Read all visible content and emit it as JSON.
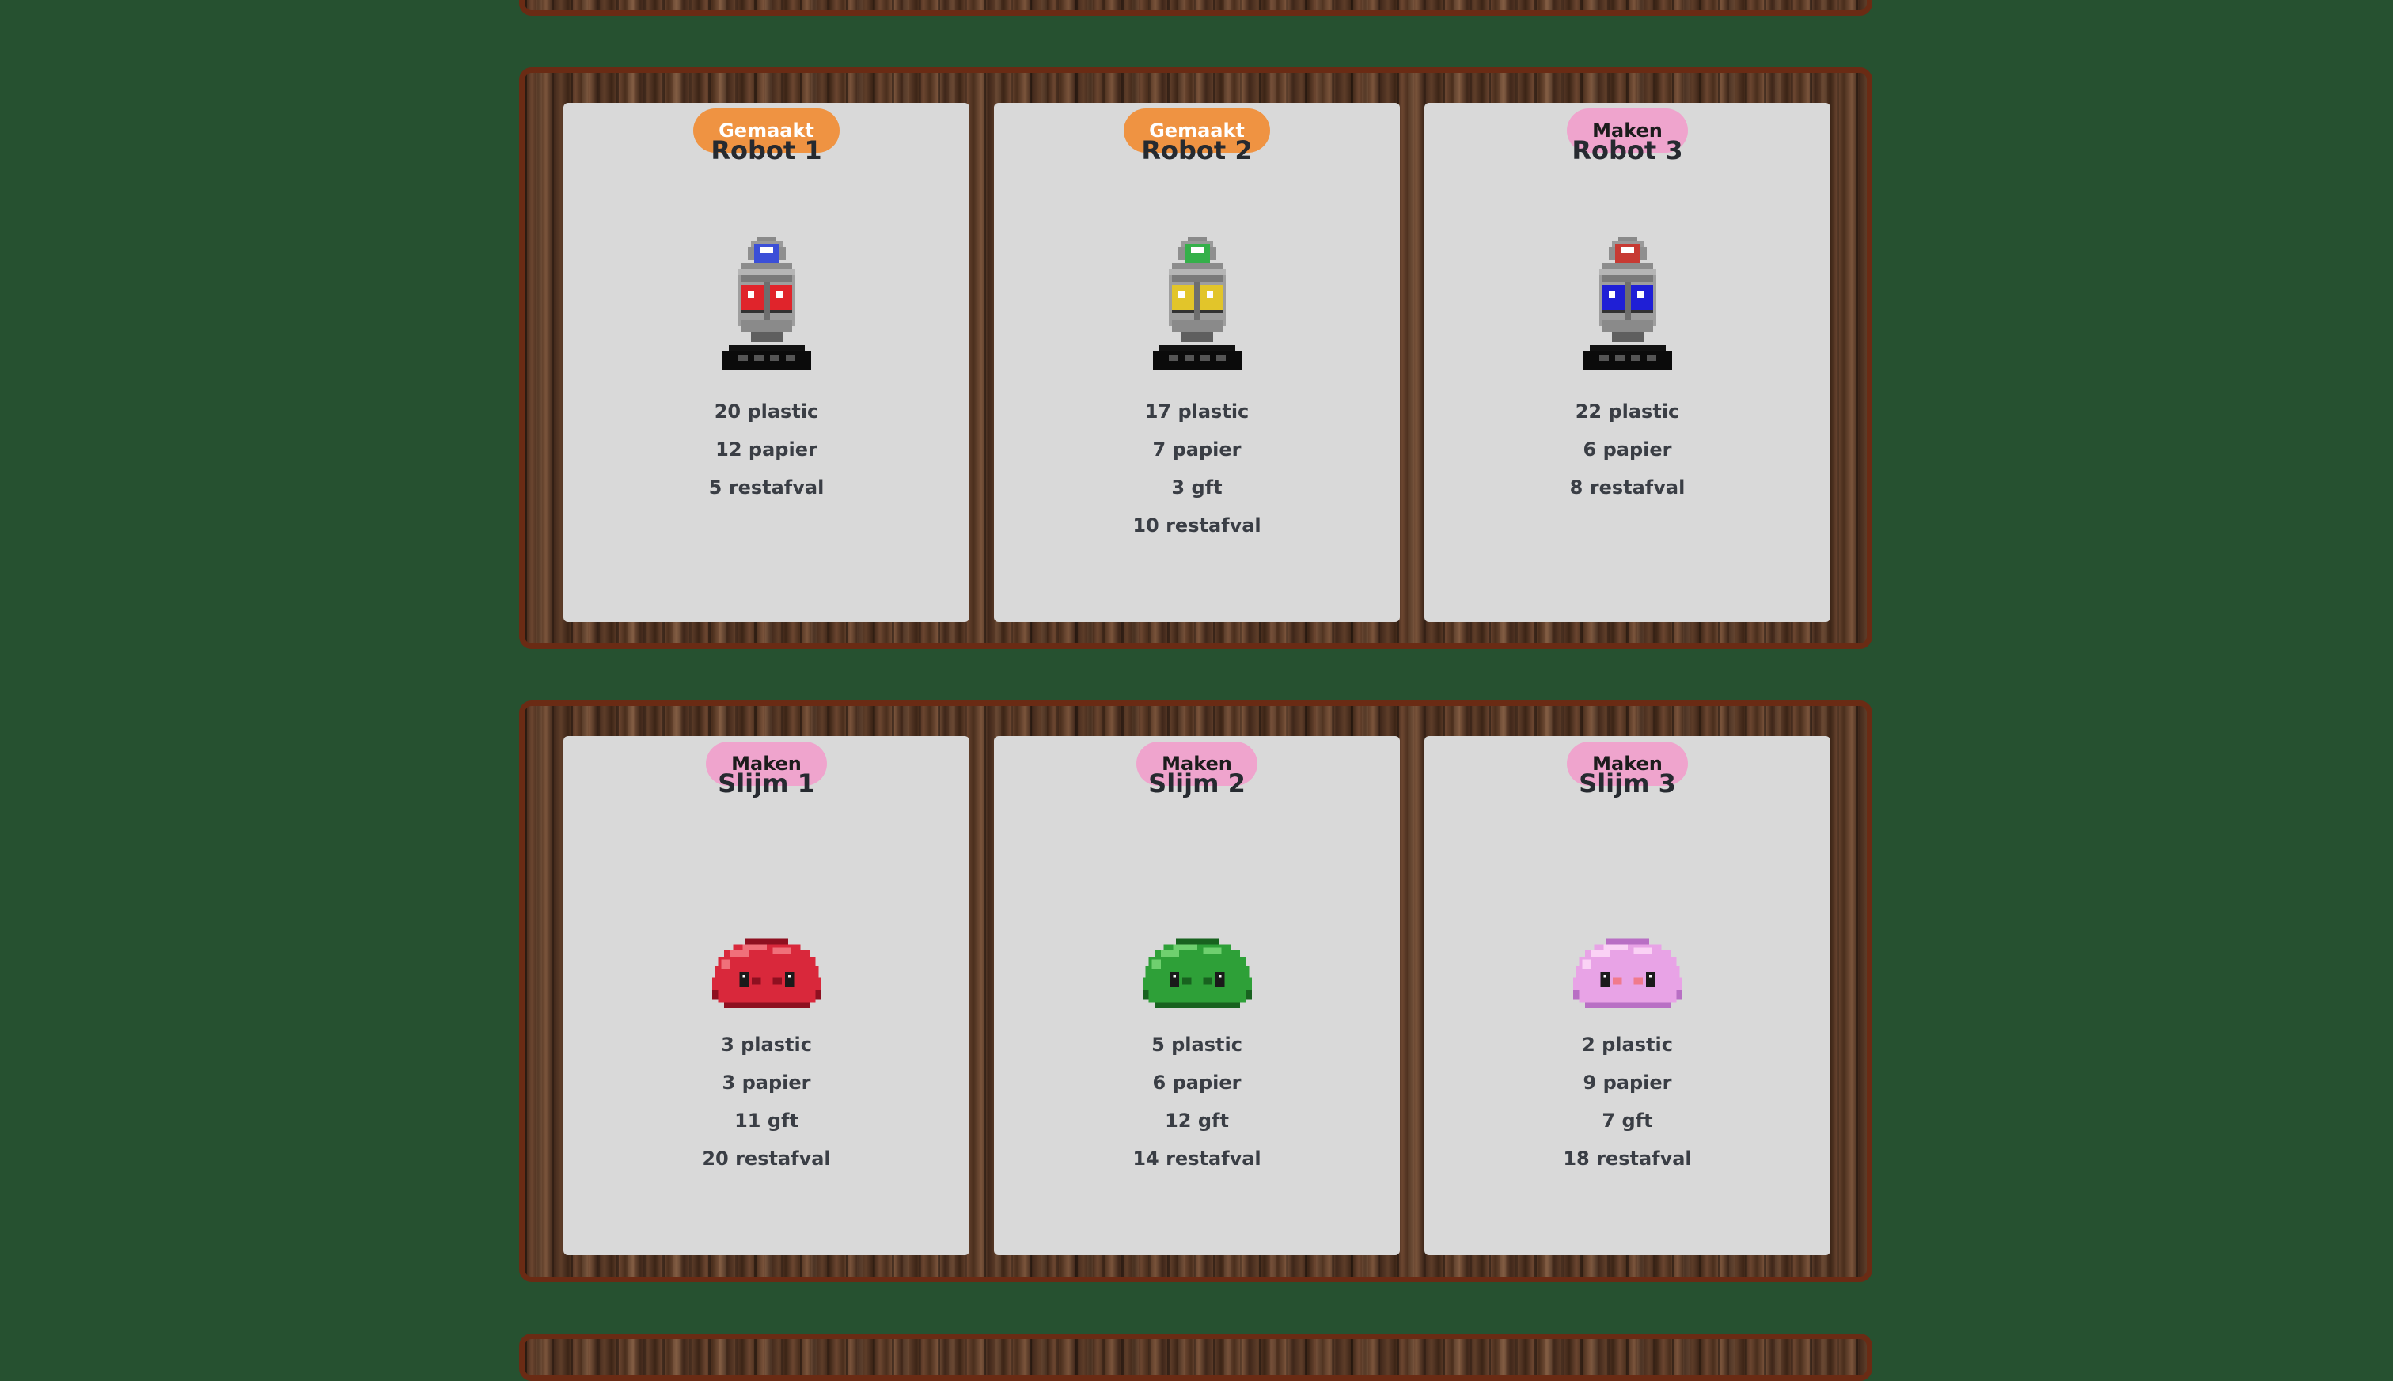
{
  "colors": {
    "background": "#265130",
    "card": "#d9d9d9",
    "gemaakt_button": "#ef9342",
    "maken_button": "#efa4cd",
    "shelf_border": "#6a2b14"
  },
  "shelves": [
    {
      "items": [
        {
          "title": "Robot 1",
          "icon": "robot-icon",
          "colors": {
            "gem": "#3b4fd8",
            "eyes": "#e0242b"
          },
          "materials": [
            "20 plastic",
            "12 papier",
            "5 restafval"
          ],
          "button": "Gemaakt",
          "status": "done"
        },
        {
          "title": "Robot 2",
          "icon": "robot-icon",
          "colors": {
            "gem": "#35b04a",
            "eyes": "#e2c52a"
          },
          "materials": [
            "17 plastic",
            "7 papier",
            "3 gft",
            "10 restafval"
          ],
          "button": "Gemaakt",
          "status": "done"
        },
        {
          "title": "Robot 3",
          "icon": "robot-icon",
          "colors": {
            "gem": "#c73a33",
            "eyes": "#1f1fd6"
          },
          "materials": [
            "22 plastic",
            "6 papier",
            "8 restafval"
          ],
          "button": "Maken",
          "status": "make"
        }
      ]
    },
    {
      "items": [
        {
          "title": "Slijm 1",
          "icon": "slime-icon",
          "colors": {
            "body": "#d9283b",
            "light": "#f0707a",
            "dark": "#8e1020",
            "cheek": "#8e1020"
          },
          "materials": [
            "3 plastic",
            "3 papier",
            "11 gft",
            "20 restafval"
          ],
          "button": "Maken",
          "status": "make"
        },
        {
          "title": "Slijm 2",
          "icon": "slime-icon",
          "colors": {
            "body": "#2ea038",
            "light": "#6fd06f",
            "dark": "#18621f",
            "cheek": "#18621f"
          },
          "materials": [
            "5 plastic",
            "6 papier",
            "12 gft",
            "14 restafval"
          ],
          "button": "Maken",
          "status": "make"
        },
        {
          "title": "Slijm 3",
          "icon": "slime-icon",
          "colors": {
            "body": "#e8a3e6",
            "light": "#fad2f5",
            "dark": "#b86fc4",
            "cheek": "#f07a8c"
          },
          "materials": [
            "2 plastic",
            "9 papier",
            "7 gft",
            "18 restafval"
          ],
          "button": "Maken",
          "status": "make"
        }
      ]
    }
  ]
}
